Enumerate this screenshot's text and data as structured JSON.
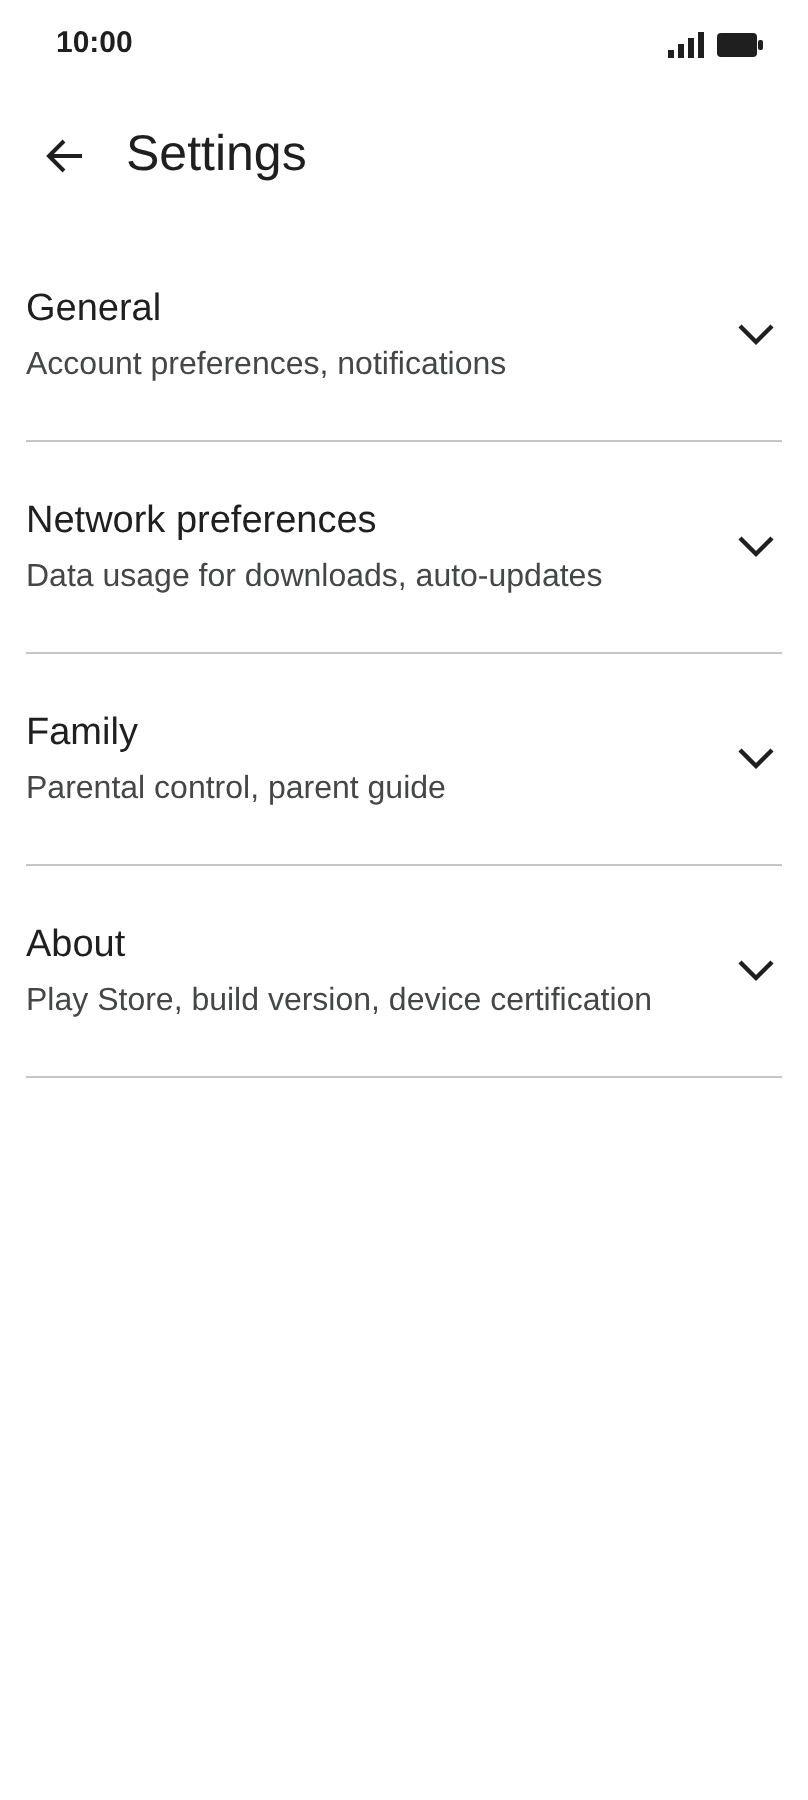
{
  "status_bar": {
    "time": "10:00"
  },
  "header": {
    "title": "Settings"
  },
  "sections": [
    {
      "title": "General",
      "subtitle": "Account preferences, notifications",
      "expanded": false
    },
    {
      "title": "Network preferences",
      "subtitle": "Data usage for downloads, auto-updates",
      "expanded": false
    },
    {
      "title": "Family",
      "subtitle": "Parental control, parent guide",
      "expanded": false
    },
    {
      "title": "About",
      "subtitle": "Play Store, build version, device certification",
      "expanded": false
    }
  ]
}
